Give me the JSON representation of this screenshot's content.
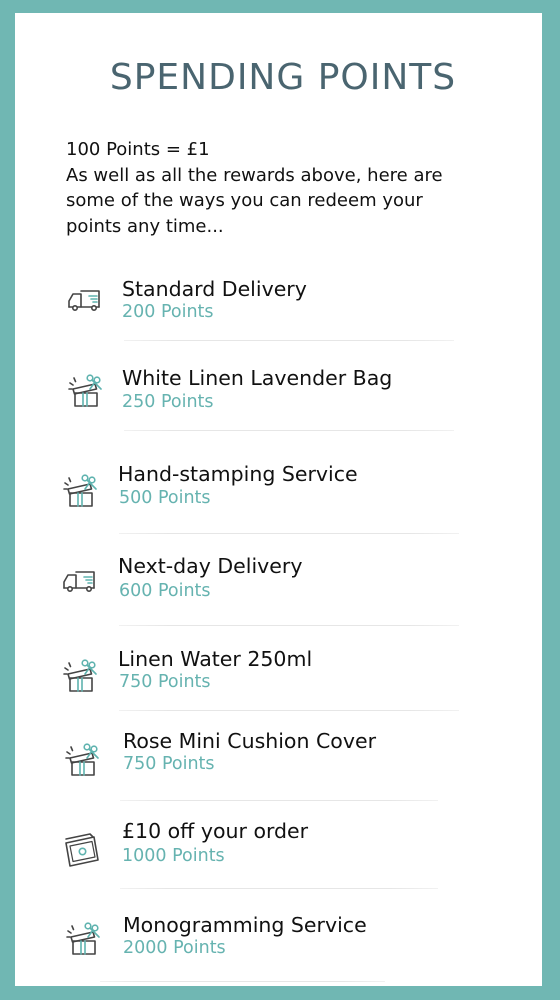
{
  "page": {
    "title": "SPENDING POINTS",
    "intro_line1": "100 Points = £1",
    "intro_line2": "As well as all the rewards above, here are some of the ways you can redeem your points any time..."
  },
  "colors": {
    "background": "#70b7b3",
    "title": "#4a6570",
    "points": "#66b3b0",
    "icon_accent": "#5fb3af",
    "icon_stroke": "#444444"
  },
  "rewards": [
    {
      "name": "Standard Delivery",
      "points": "200 Points",
      "icon": "delivery-truck-icon"
    },
    {
      "name": "White Linen Lavender Bag",
      "points": "250 Points",
      "icon": "gift-box-icon"
    },
    {
      "name": "Hand-stamping Service",
      "points": "500 Points",
      "icon": "gift-box-icon"
    },
    {
      "name": "Next-day Delivery",
      "points": "600 Points",
      "icon": "delivery-truck-icon"
    },
    {
      "name": "Linen Water 250ml",
      "points": "750 Points",
      "icon": "gift-box-icon"
    },
    {
      "name": "Rose Mini Cushion Cover",
      "points": "750 Points",
      "icon": "gift-box-icon"
    },
    {
      "name": "£10 off your order",
      "points": "1000 Points",
      "icon": "voucher-icon"
    },
    {
      "name": "Monogramming Service",
      "points": "2000 Points",
      "icon": "gift-box-icon"
    }
  ]
}
